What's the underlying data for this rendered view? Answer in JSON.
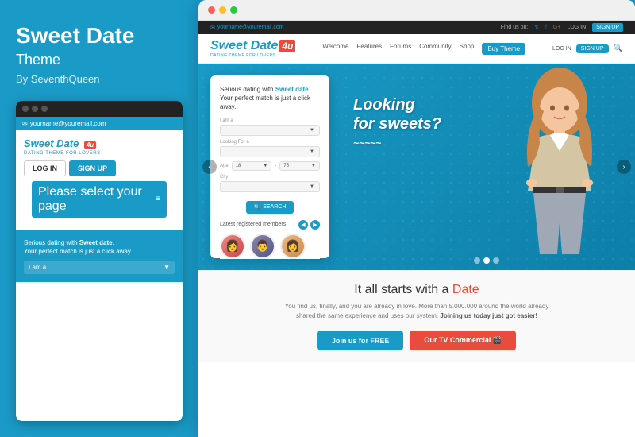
{
  "left": {
    "title": "Sweet Date",
    "subtitle": "Theme",
    "author": "By SeventhQueen",
    "mobile": {
      "email": "yourname@youremail.com",
      "logo": "Sweet Date",
      "logo_num": "4u",
      "tagline": "DATING THEME FOR LOVERS",
      "login_label": "LOG IN",
      "signup_label": "SIGN UP",
      "select_placeholder": "Please select your page",
      "search_title_1": "Serious dating with ",
      "search_title_bold": "Sweet date",
      "search_title_2": ".",
      "search_title_3": "Your perfect match is just a click away.",
      "iam_label": "I am a"
    }
  },
  "browser": {
    "dots": [
      "red",
      "yellow",
      "green"
    ]
  },
  "website": {
    "topbar": {
      "email": "yourname@youremail.com",
      "find_us": "Find us on:",
      "login": "LOG IN",
      "signup": "SIGN UP"
    },
    "nav": {
      "logo": "Sweet Date",
      "logo_num": "4u",
      "tagline": "DATING THEME FOR LOVERS",
      "links": [
        "Welcome",
        "Features",
        "Forums",
        "Community",
        "Shop",
        "Buy Theme"
      ],
      "login": "LOG IN",
      "signup": "SIGN UP"
    },
    "hero": {
      "form_title_1": "Serious dating with ",
      "form_title_bold": "Sweet date",
      "form_title_2": ". Your perfect match is just a click away.",
      "iam_label": "I am a",
      "looking_label": "Looking For a",
      "age_label": "Age",
      "age_min": "18",
      "age_max": "75",
      "city_label": "City",
      "search_btn": "SEARCH",
      "members_label": "Latest registered members",
      "nav_left": "‹",
      "nav_right": "›",
      "text_line1": "Looking",
      "text_line2": "for sweets?",
      "dots": [
        false,
        true,
        false
      ]
    },
    "bottom": {
      "title_1": "It all starts with a ",
      "title_date": "Date",
      "desc": "You find us, finally, and you are already in love. More than 5.000.000 around the world already shared the same experience and uses our system. ",
      "desc_bold": "Joining us today just got easier!",
      "btn1": "Join us for FREE",
      "btn2": "Our TV Commercial 🎬"
    }
  }
}
